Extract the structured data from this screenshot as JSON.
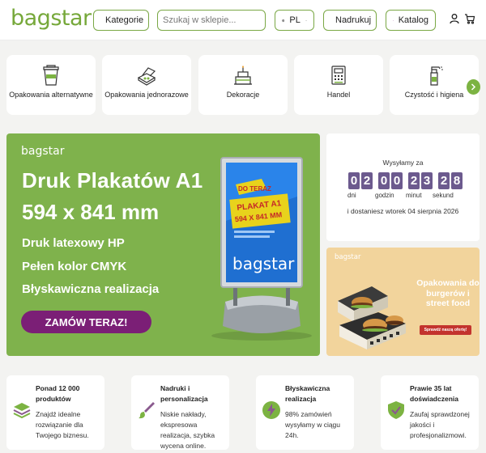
{
  "header": {
    "logo": "bagstar",
    "categories_label": "Kategorie",
    "search_placeholder": "Szukaj w sklepie...",
    "language": "PL",
    "print_label": "Nadrukuj",
    "catalog_label": "Katalog"
  },
  "categories": [
    {
      "label": "Opakowania alternatywne",
      "icon": "cup-icon"
    },
    {
      "label": "Opakowania jednorazowe",
      "icon": "food-box-icon"
    },
    {
      "label": "Dekoracje",
      "icon": "cake-icon"
    },
    {
      "label": "Handel",
      "icon": "cash-register-icon"
    },
    {
      "label": "Czystość i higiena",
      "icon": "spray-bottle-icon"
    }
  ],
  "hero": {
    "logo": "bagstar",
    "title1": "Druk Plakatów A1",
    "title2": "594 x 841 mm",
    "features": [
      "Druk latexowy HP",
      "Pełen kolor CMYK",
      "Błyskawiczna realizacja"
    ],
    "cta": "ZAMÓW TERAZ!",
    "poster_badge": "DO TERAZ",
    "poster_line1": "PLAKAT A1",
    "poster_line2": "594 X 841 MM",
    "poster_brand": "bagstar"
  },
  "countdown": {
    "title": "Wysyłamy za",
    "digits": [
      "0",
      "2",
      "0",
      "0",
      "2",
      "3",
      "2",
      "8"
    ],
    "labels": [
      "dni",
      "godzin",
      "minut",
      "sekund"
    ],
    "delivery": "i dostaniesz wtorek 04 sierpnia 2026"
  },
  "promo": {
    "logo": "bagstar",
    "text": "Opakowania do burgerów i street food",
    "button": "Sprawdź naszą ofertę!"
  },
  "features": [
    {
      "title": "Ponad 12 000 produktów",
      "desc": "Znajdź idealne rozwiązanie dla Twojego biznesu.",
      "icon": "layers-icon"
    },
    {
      "title": "Nadruki i personalizacja",
      "desc": "Niskie nakłady, ekspresowa realizacja, szybka wycena online.",
      "icon": "brush-icon"
    },
    {
      "title": "Błyskawiczna realizacja",
      "desc": "98% zamówień wysyłamy w ciągu 24h.",
      "icon": "lightning-icon"
    },
    {
      "title": "Prawie 35 lat doświadczenia",
      "desc": "Zaufaj sprawdzonej jakości i profesjonalizmowi.",
      "icon": "shield-check-icon"
    }
  ],
  "colors": {
    "brand_green": "#76a83a",
    "hero_green": "#7fb24c",
    "cta_purple": "#7b1f76",
    "countdown_purple": "#6c5a8e"
  }
}
